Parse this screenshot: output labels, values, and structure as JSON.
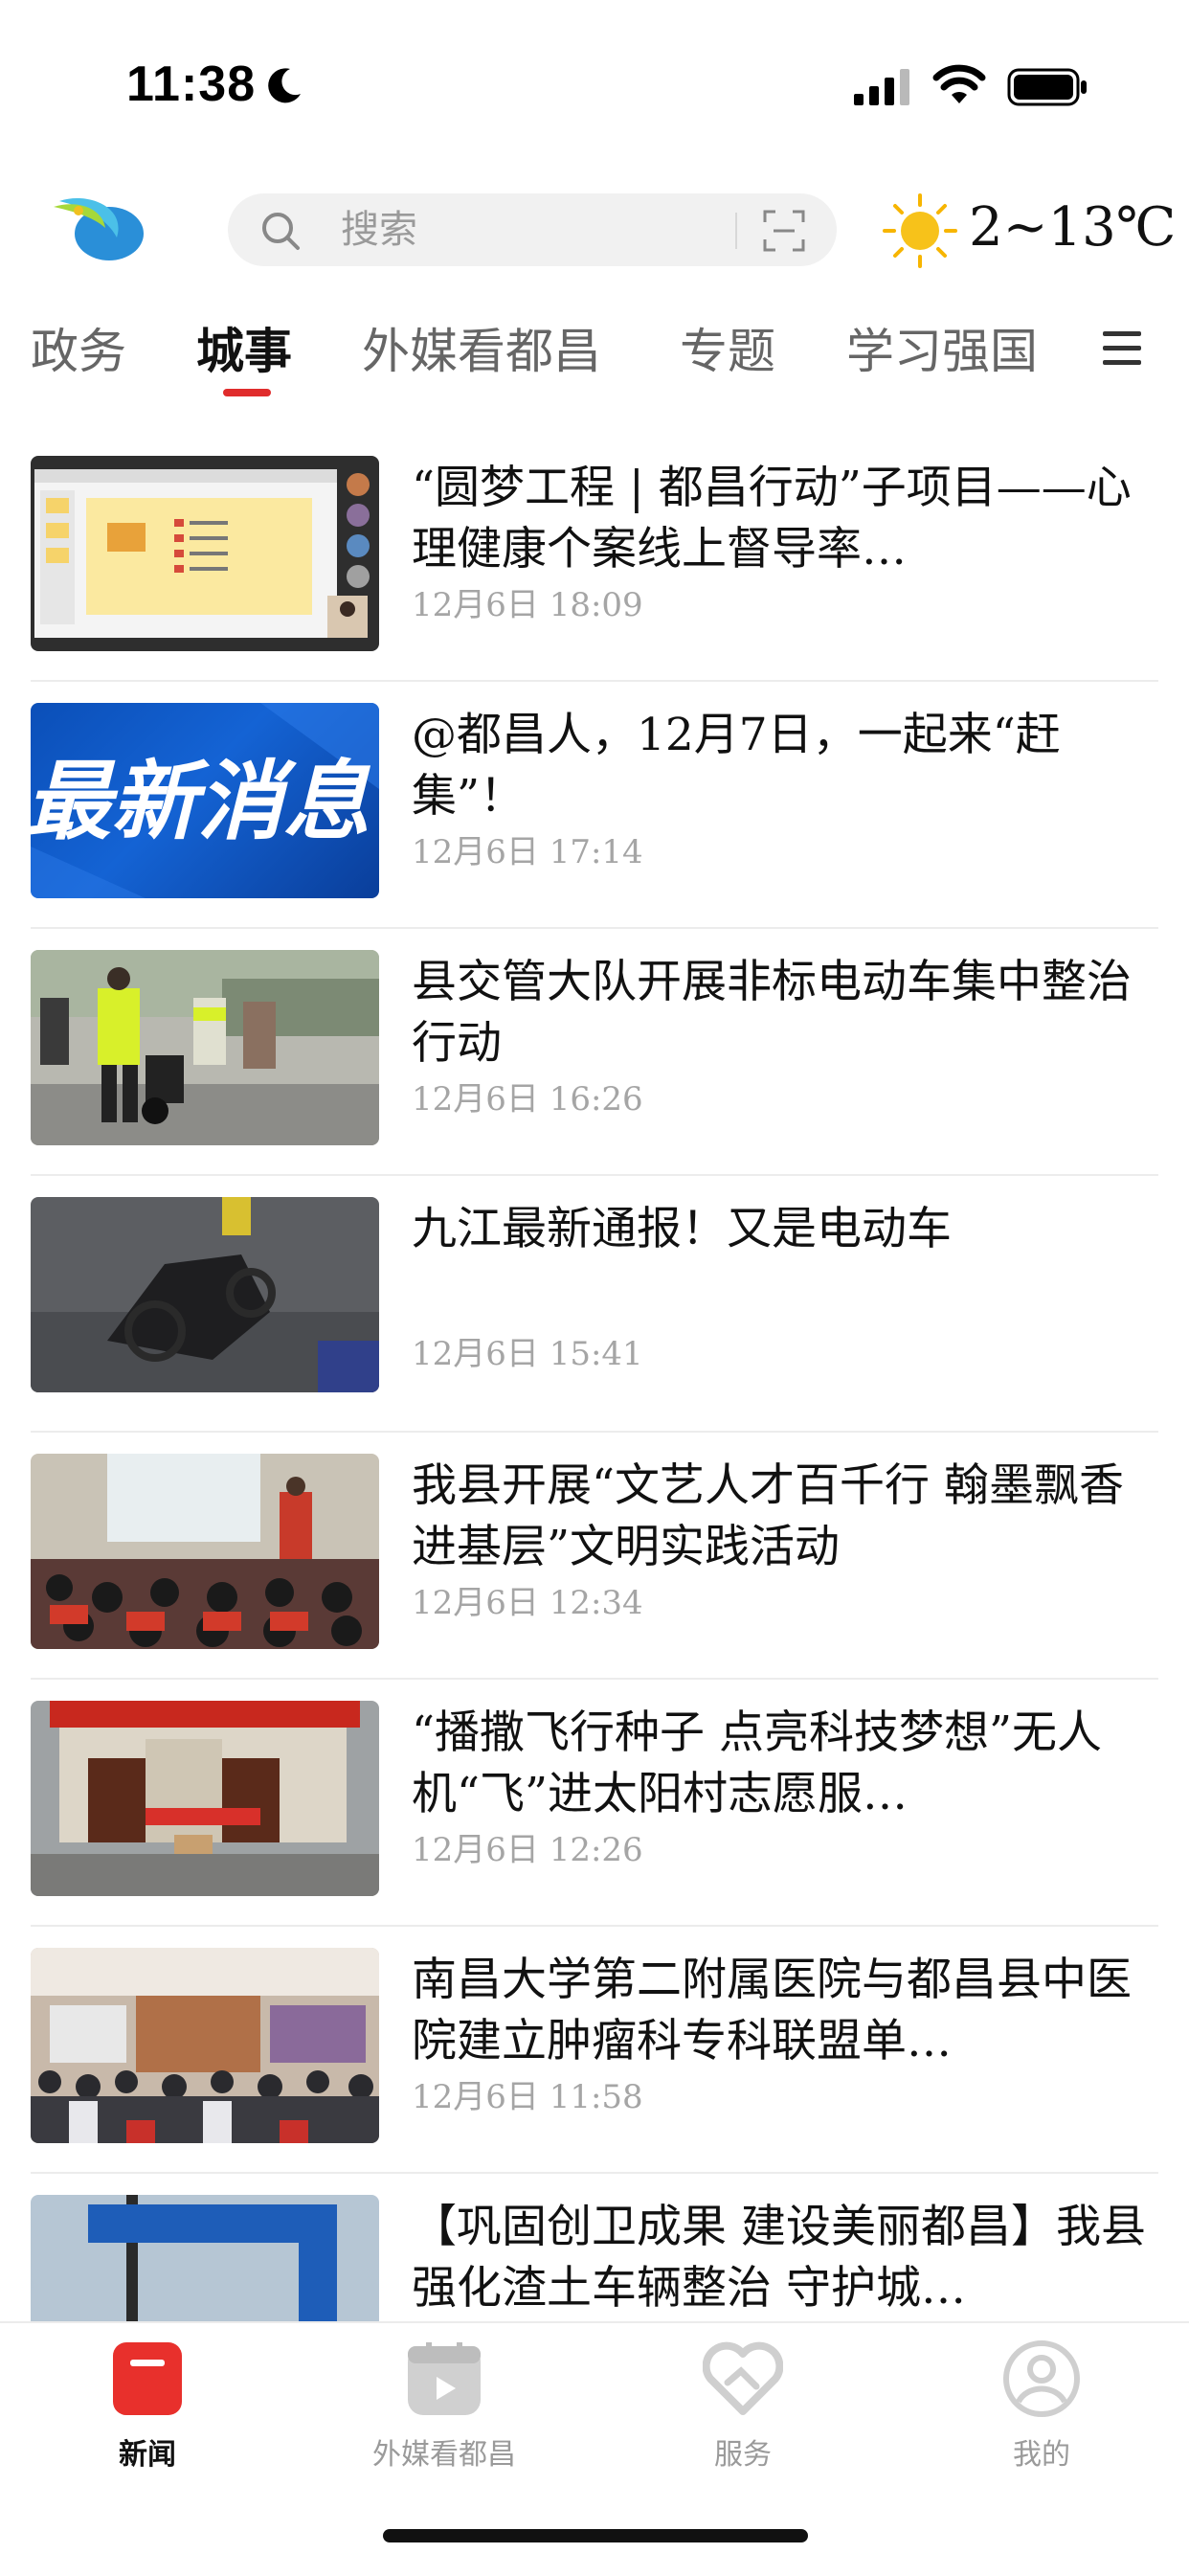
{
  "status_bar": {
    "time": "11:38"
  },
  "header": {
    "search_placeholder": "搜索",
    "weather": {
      "temperature": "2~13℃",
      "icon": "sun-icon"
    },
    "logo": "app-logo"
  },
  "tabs": [
    {
      "label": "政务",
      "active": false
    },
    {
      "label": "城事",
      "active": true
    },
    {
      "label": "外媒看都昌",
      "active": false
    },
    {
      "label": "专题",
      "active": false
    },
    {
      "label": "学习强国",
      "active": false
    }
  ],
  "news": [
    {
      "title": "“圆梦工程 | 都昌行动”子项目——心理健康个案线上督导率…",
      "time": "12月6日  18:09"
    },
    {
      "title": "@都昌人，12月7日，一起来“赶集”！",
      "time": "12月6日  17:14",
      "thumb_text": "最新消息"
    },
    {
      "title": "县交管大队开展非标电动车集中整治行动",
      "time": "12月6日  16:26"
    },
    {
      "title": "九江最新通报！又是电动车",
      "time": "12月6日  15:41"
    },
    {
      "title": "我县开展“文艺人才百千行    翰墨飘香进基层”文明实践活动",
      "time": "12月6日  12:34"
    },
    {
      "title": "“播撒飞行种子  点亮科技梦想”无人机“飞”进太阳村志愿服…",
      "time": "12月6日  12:26"
    },
    {
      "title": "南昌大学第二附属医院与都昌县中医院建立肿瘤科专科联盟单…",
      "time": "12月6日  11:58"
    },
    {
      "title": "【巩固创卫成果  建设美丽都昌】我县强化渣土车辆整治  守护城…",
      "time": ""
    }
  ],
  "bottom_nav": [
    {
      "label": "新闻",
      "icon": "news-icon",
      "active": true
    },
    {
      "label": "外媒看都昌",
      "icon": "calendar-icon",
      "active": false
    },
    {
      "label": "服务",
      "icon": "handshake-icon",
      "active": false
    },
    {
      "label": "我的",
      "icon": "profile-icon",
      "active": false
    }
  ],
  "colors": {
    "accent": "#e02c2c",
    "tab_inactive": "#666666",
    "muted": "#a5a5a5"
  }
}
